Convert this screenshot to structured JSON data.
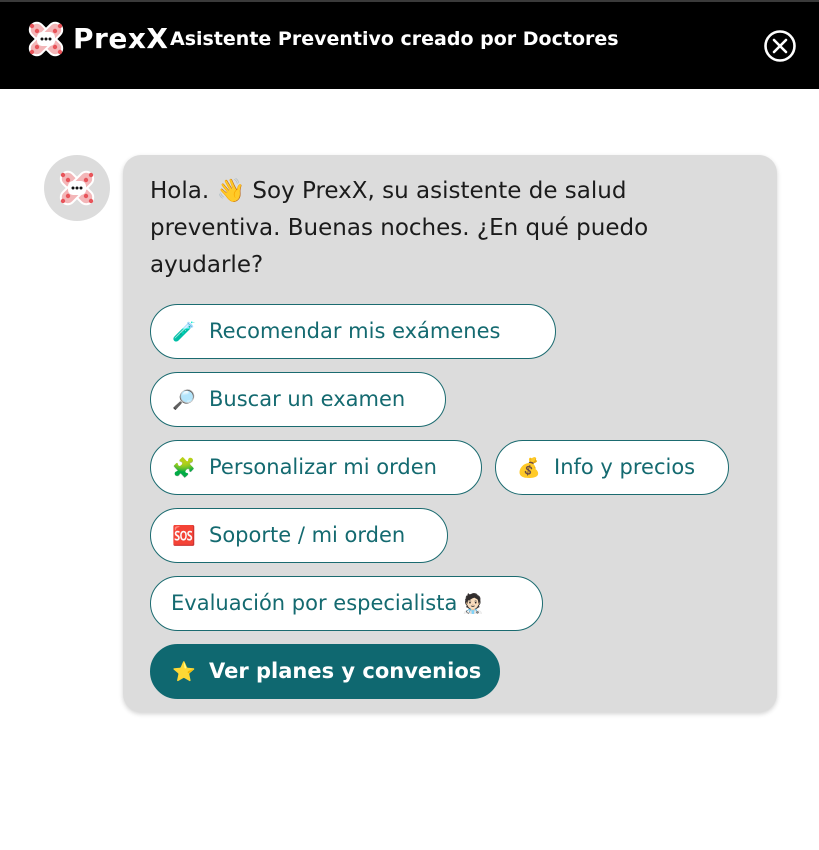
{
  "header": {
    "brand": "PrexX",
    "title": "Asistente Preventivo creado por Doctores",
    "logo_icon": "prexx-cross-logo-icon",
    "close_icon": "close-circle-icon"
  },
  "chat": {
    "avatar_icon": "prexx-bot-avatar-icon",
    "greeting": "Hola. 👋 Soy PrexX, su asistente de salud preventiva. Buenas noches. ¿En qué puedo ayudarle?",
    "options": [
      {
        "emoji": "🧪",
        "label": "Recomendar mis exámenes"
      },
      {
        "emoji": "🔎",
        "label": "Buscar un examen"
      },
      {
        "emoji": "🧩",
        "label": "Personalizar mi orden"
      },
      {
        "emoji": "💰",
        "label": "Info y precios"
      },
      {
        "emoji": "🆘",
        "label": "Soporte / mi orden"
      },
      {
        "emoji": "🧑🏻‍⚕️",
        "label": "Evaluación por especialista"
      },
      {
        "emoji": "⭐",
        "label": "Ver planes y convenios"
      }
    ]
  },
  "colors": {
    "header_bg": "#000000",
    "accent": "#0f6870",
    "bubble_bg": "#dcdcdc",
    "logo_red": "#e8545a"
  }
}
